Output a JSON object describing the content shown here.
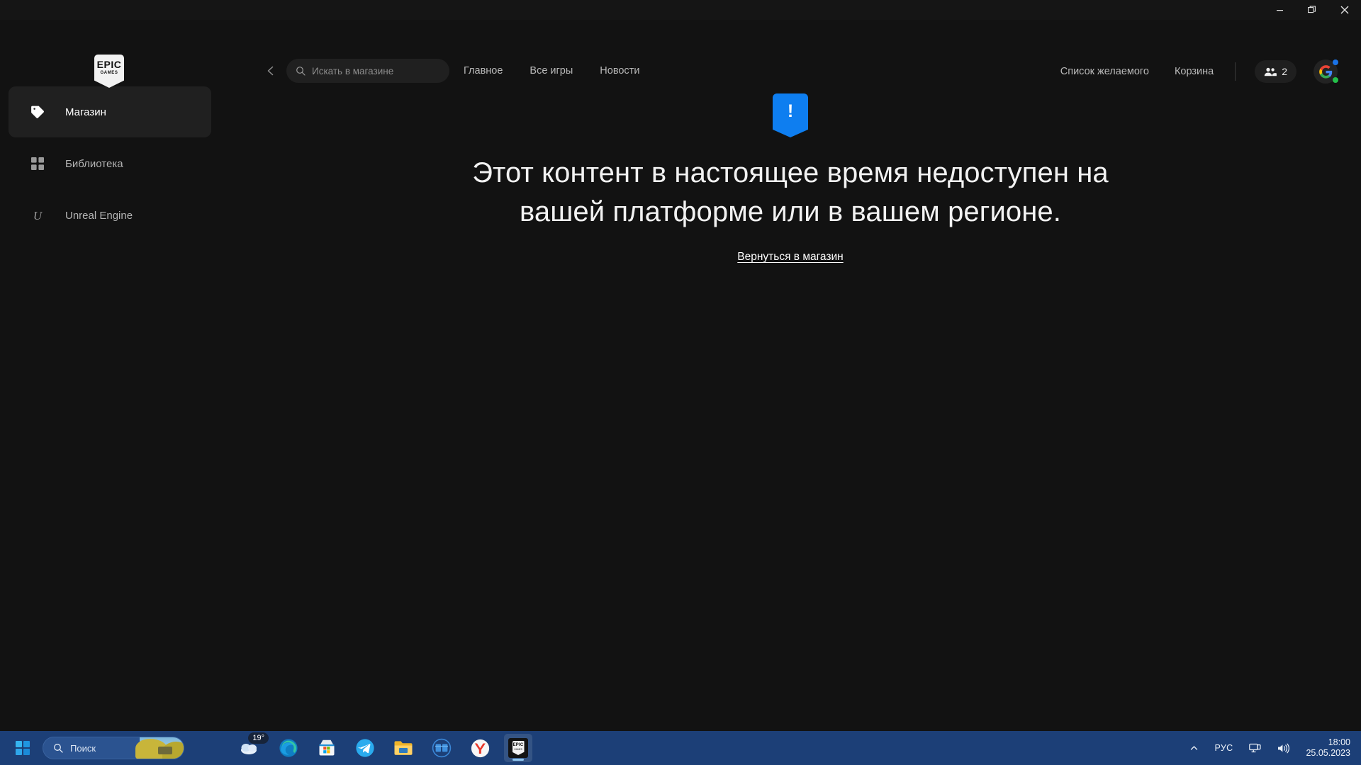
{
  "window": {
    "controls": {
      "minimize": "minimize-icon",
      "restore": "restore-icon",
      "close": "close-icon"
    }
  },
  "header": {
    "logo": {
      "line1": "EPIC",
      "line2": "GAMES"
    },
    "back_icon": "chevron-left-icon",
    "search": {
      "icon": "search-icon",
      "placeholder": "Искать в магазине",
      "value": ""
    },
    "nav": [
      {
        "label": "Главное"
      },
      {
        "label": "Все игры"
      },
      {
        "label": "Новости"
      }
    ],
    "right": {
      "wishlist_label": "Список желаемого",
      "cart_label": "Корзина",
      "friends": {
        "icon": "people-icon",
        "count": "2"
      },
      "avatar": {
        "letter": "G",
        "status_dot": "#24c04a",
        "notify_dot": "#1a73e8"
      }
    }
  },
  "sidebar": {
    "items": [
      {
        "label": "Магазин",
        "icon": "tag-icon",
        "active": true
      },
      {
        "label": "Библиотека",
        "icon": "grid-icon",
        "active": false
      },
      {
        "label": "Unreal Engine",
        "icon": "unreal-icon",
        "active": false
      }
    ]
  },
  "main": {
    "alert_icon": "!",
    "alert_color": "#0e7ef0",
    "title": "Этот контент в настоящее время недоступен на вашей платформе или в вашем регионе.",
    "link_label": "Вернуться в магазин"
  },
  "taskbar": {
    "start_icon": "windows-logo-icon",
    "search": {
      "icon": "search-icon",
      "label": "Поиск"
    },
    "apps": [
      {
        "name": "weather",
        "badge": "19°"
      },
      {
        "name": "edge",
        "badge": ""
      },
      {
        "name": "microsoft-store",
        "badge": ""
      },
      {
        "name": "telegram",
        "badge": ""
      },
      {
        "name": "file-explorer",
        "badge": ""
      },
      {
        "name": "gs-app",
        "badge": ""
      },
      {
        "name": "yandex-browser",
        "badge": ""
      },
      {
        "name": "epic-games-launcher",
        "badge": ""
      }
    ],
    "tray": {
      "overflow_icon": "chevron-up-icon",
      "language": "РУС",
      "network_icon": "network-icon",
      "volume_icon": "volume-icon",
      "time": "18:00",
      "date": "25.05.2023"
    }
  }
}
